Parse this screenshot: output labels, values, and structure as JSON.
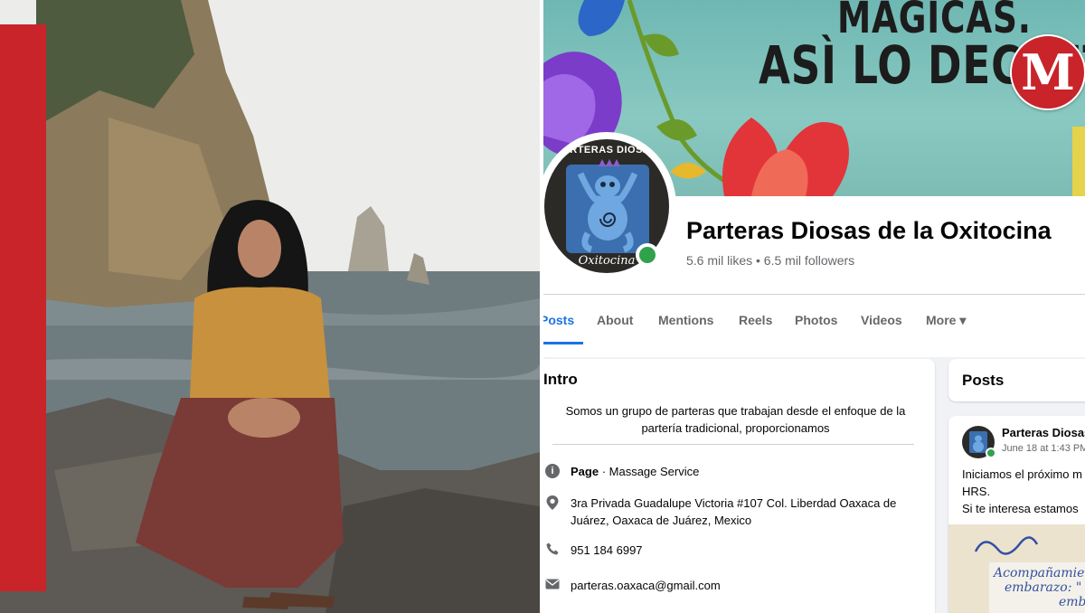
{
  "cover": {
    "line1": "MAGICAS.",
    "line2": "ASÌ LO DECRETO",
    "logo_letter": "M"
  },
  "page": {
    "avatar_title": "PARTERAS DIOSAS",
    "avatar_subtitle": "Oxitocina",
    "name": "Parteras Diosas de la Oxitocina",
    "stats": "5.6 mil likes • 6.5 mil followers"
  },
  "tabs": [
    {
      "label": "Posts",
      "active": true
    },
    {
      "label": "About"
    },
    {
      "label": "Mentions"
    },
    {
      "label": "Reels"
    },
    {
      "label": "Photos"
    },
    {
      "label": "Videos"
    },
    {
      "label": "More ▾"
    }
  ],
  "intro": {
    "heading": "Intro",
    "bio_line1": "Somos un grupo de parteras que trabajan desde el enfoque de la",
    "bio_line2": "partería tradicional, proporcionamos",
    "page_type_bold": "Page",
    "page_type_rest": " · Massage Service",
    "address_line1": "3ra Privada Guadalupe Victoria #107 Col. Liberdad Oaxaca de",
    "address_line2": "Juárez, Oaxaca de Juárez, Mexico",
    "phone": "951 184 6997",
    "email": "parteras.oaxaca@gmail.com"
  },
  "posts": {
    "heading": "Posts",
    "author": "Parteras Diosas",
    "date": "June 18 at 1:43 PM",
    "text_line1": "Iniciamos el próximo m",
    "text_line2": "HRS.",
    "text_line3": "Si te interesa estamos",
    "image_text_line1": "Acompañamie",
    "image_text_line2": "embarazo: \"",
    "image_text_line3": "embe"
  },
  "colors": {
    "brand_red": "#c8242a",
    "facebook_blue": "#1b74e4",
    "online_green": "#31a24c"
  }
}
